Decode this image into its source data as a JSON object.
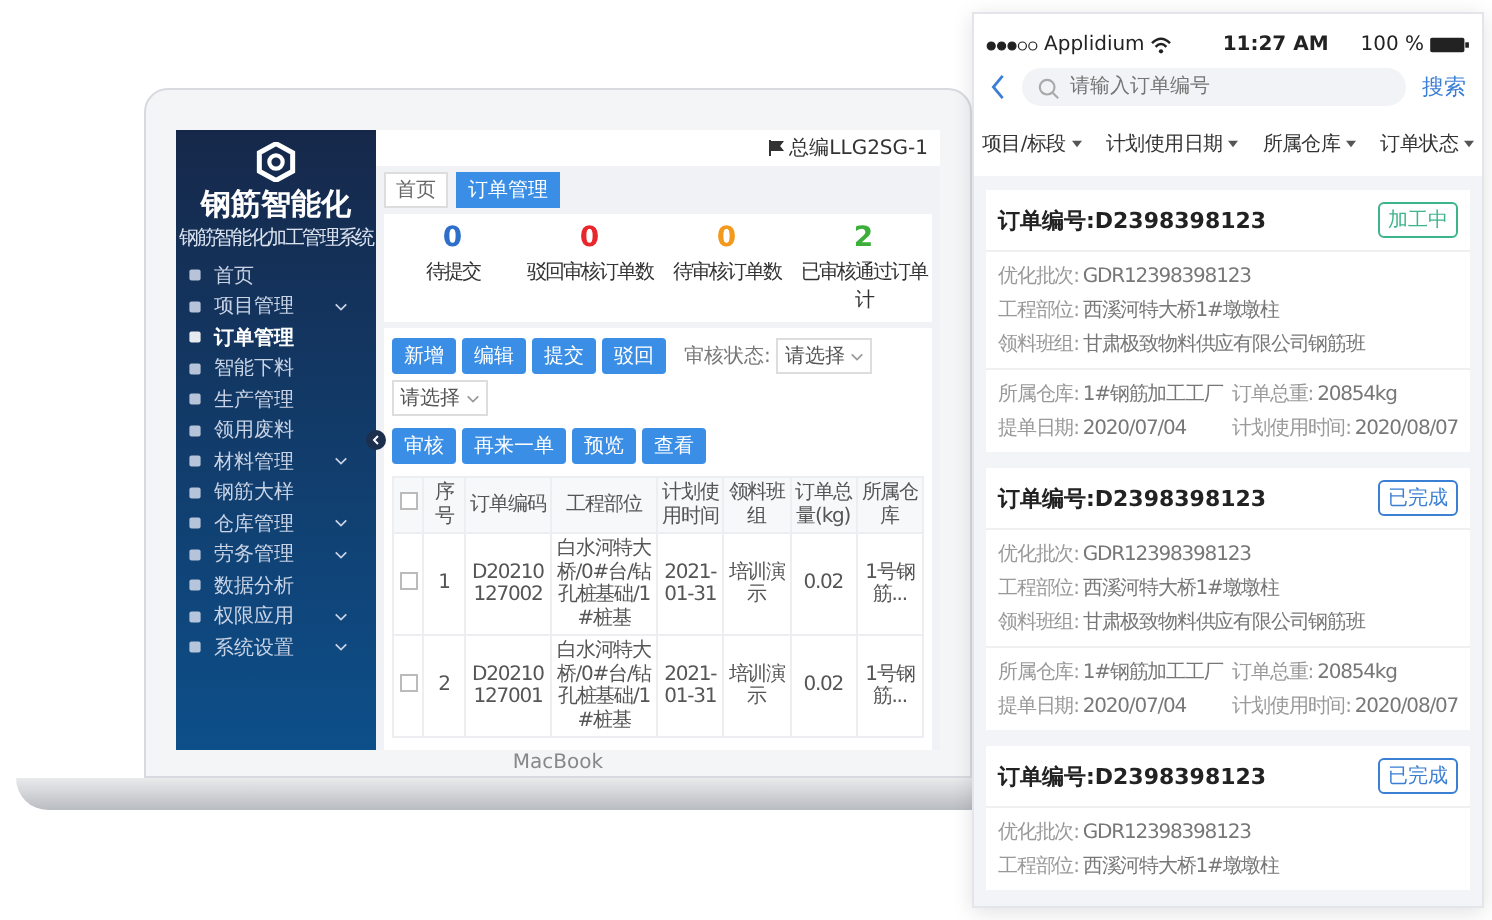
{
  "laptop": {
    "brand": "MacBook",
    "sidebar": {
      "title": "钢筋智能化",
      "subtitle": "钢筋智能化加工管理系统",
      "items": [
        {
          "label": "首页",
          "selected": false,
          "expandable": false
        },
        {
          "label": "项目管理",
          "selected": false,
          "expandable": true
        },
        {
          "label": "订单管理",
          "selected": true,
          "expandable": false
        },
        {
          "label": "智能下料",
          "selected": false,
          "expandable": false
        },
        {
          "label": "生产管理",
          "selected": false,
          "expandable": false
        },
        {
          "label": "领用废料",
          "selected": false,
          "expandable": false
        },
        {
          "label": "材料管理",
          "selected": false,
          "expandable": true
        },
        {
          "label": "钢筋大样",
          "selected": false,
          "expandable": false
        },
        {
          "label": "仓库管理",
          "selected": false,
          "expandable": true
        },
        {
          "label": "劳务管理",
          "selected": false,
          "expandable": true
        },
        {
          "label": "数据分析",
          "selected": false,
          "expandable": false
        },
        {
          "label": "权限应用",
          "selected": false,
          "expandable": true
        },
        {
          "label": "系统设置",
          "selected": false,
          "expandable": true
        }
      ]
    },
    "user": "总编LLG2SG-1",
    "tabs": [
      {
        "label": "首页",
        "selected": false
      },
      {
        "label": "订单管理",
        "selected": true
      }
    ],
    "stats": [
      {
        "value": "0",
        "label": "待提交",
        "color": "#2f6fc9"
      },
      {
        "value": "0",
        "label": "驳回审核订单数",
        "color": "#e8262b"
      },
      {
        "value": "0",
        "label": "待审核订单数",
        "color": "#f39a1e"
      },
      {
        "value": "2",
        "label": "已审核通过订单计",
        "color": "#3cae3a"
      }
    ],
    "buttons": [
      "新增",
      "编辑",
      "提交",
      "驳回",
      "审核",
      "再来一单",
      "预览",
      "查看"
    ],
    "filters": [
      {
        "label": "审核状态:",
        "placeholder": "请选择"
      },
      {
        "placeholder": "请选择"
      }
    ],
    "table": {
      "header_checked": false,
      "columns": [
        "序号",
        "订单编码",
        "工程部位",
        "计划使用时间",
        "领料班组",
        "订单总量(kg)",
        "所属仓库"
      ],
      "rows": [
        {
          "checked": false,
          "cells": [
            "1",
            "D20210127002",
            "白水河特大桥/0#台/钻孔桩基础/1#桩基",
            "2021-01-31",
            "培训演示",
            "0.02",
            "1号钢筋..."
          ]
        },
        {
          "checked": false,
          "cells": [
            "2",
            "D20210127001",
            "白水河特大桥/0#台/钻孔桩基础/1#桩基",
            "2021-01-31",
            "培训演示",
            "0.02",
            "1号钢筋..."
          ]
        }
      ]
    }
  },
  "phone": {
    "status": {
      "carrier": "Applidium",
      "time": "11:27 AM",
      "battery": "100 %"
    },
    "search": {
      "placeholder": "请输入订单编号",
      "button": "搜索"
    },
    "filters": [
      "项目/标段",
      "计划使用日期",
      "所属仓库",
      "订单状态"
    ],
    "orders": [
      {
        "title": "订单编号:D2398398123",
        "status": "加工中",
        "color": "#3db58a",
        "fields": [
          {
            "label": "优化批次:",
            "value": "GDR12398398123"
          },
          {
            "label": "工程部位:",
            "value": "西溪河特大桥1#墩墩柱"
          },
          {
            "label": "领料班组:",
            "value": "甘肃极致物料供应有限公司钢筋班"
          }
        ],
        "details": [
          {
            "label": "所属仓库:",
            "value": "1#钢筋加工工厂"
          },
          {
            "label": "订单总重:",
            "value": "20854kg"
          },
          {
            "label": "提单日期:",
            "value": "2020/07/04"
          },
          {
            "label": "计划使用时间:",
            "value": "2020/08/07"
          }
        ]
      },
      {
        "title": "订单编号:D2398398123",
        "status": "已完成",
        "color": "#3b7fd4",
        "fields": [
          {
            "label": "优化批次:",
            "value": "GDR12398398123"
          },
          {
            "label": "工程部位:",
            "value": "西溪河特大桥1#墩墩柱"
          },
          {
            "label": "领料班组:",
            "value": "甘肃极致物料供应有限公司钢筋班"
          }
        ],
        "details": [
          {
            "label": "所属仓库:",
            "value": "1#钢筋加工工厂"
          },
          {
            "label": "订单总重:",
            "value": "20854kg"
          },
          {
            "label": "提单日期:",
            "value": "2020/07/04"
          },
          {
            "label": "计划使用时间:",
            "value": "2020/08/07"
          }
        ]
      },
      {
        "title": "订单编号:D2398398123",
        "status": "已完成",
        "color": "#3b7fd4",
        "fields": [
          {
            "label": "优化批次:",
            "value": "GDR12398398123"
          },
          {
            "label": "工程部位:",
            "value": "西溪河特大桥1#墩墩柱"
          }
        ]
      }
    ]
  }
}
